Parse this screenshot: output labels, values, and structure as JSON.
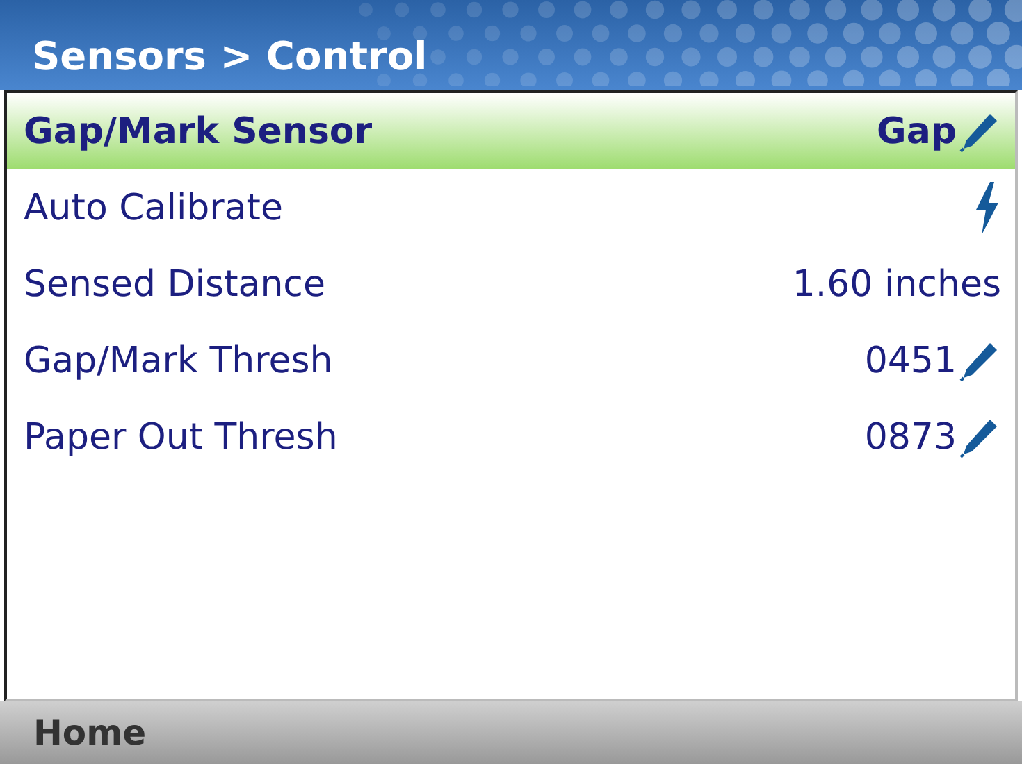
{
  "header": {
    "title": "Sensors > Control"
  },
  "rows": [
    {
      "label": "Gap/Mark Sensor",
      "value": "Gap",
      "kind": "edit",
      "selected": true
    },
    {
      "label": "Auto Calibrate",
      "kind": "action",
      "selected": false
    },
    {
      "label": "Sensed Distance",
      "value": "1.60 inches",
      "kind": "text",
      "selected": false
    },
    {
      "label": "Gap/Mark Thresh",
      "value": "0451",
      "kind": "edit",
      "selected": false
    },
    {
      "label": "Paper Out Thresh",
      "value": "0873",
      "kind": "edit",
      "selected": false
    }
  ],
  "footer": {
    "button": "Home"
  }
}
